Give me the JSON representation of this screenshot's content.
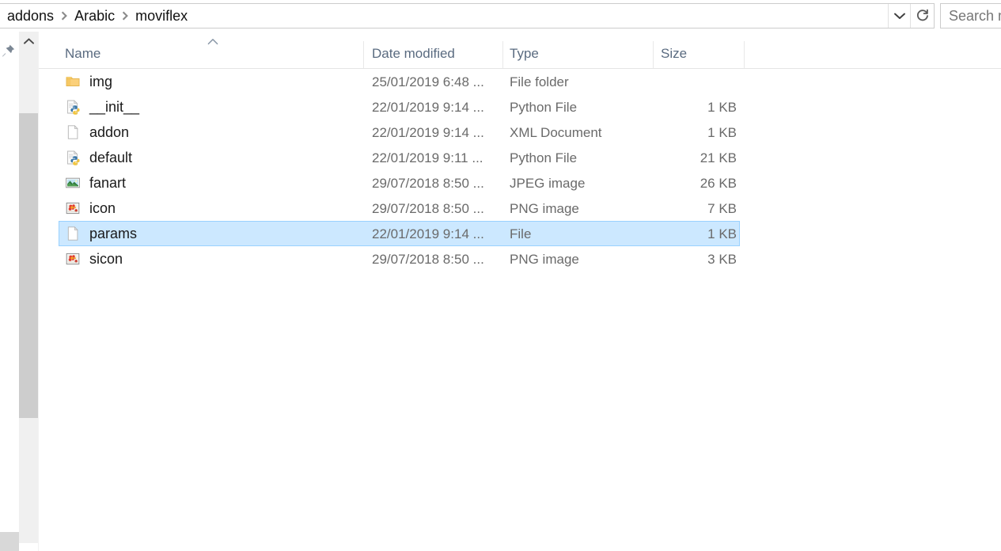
{
  "window": {
    "accent_selection_fill": "#cce8ff",
    "accent_selection_border": "#99d1ff",
    "header_text_color": "#5a6b80"
  },
  "address_bar": {
    "breadcrumb": [
      "addons",
      "Arabic",
      "moviflex"
    ],
    "separator_icon": "chevron-right-icon",
    "dropdown_icon": "chevron-down-icon",
    "refresh_icon": "refresh-icon"
  },
  "search": {
    "value": "",
    "visible_text": "Search m",
    "placeholder": "Search moviflex"
  },
  "nav_pane": {
    "pin_icon": "pin-icon",
    "scroll_up_icon": "chevron-up-icon"
  },
  "file_list": {
    "columns": [
      {
        "label": "Name",
        "key": "name"
      },
      {
        "label": "Date modified",
        "key": "date"
      },
      {
        "label": "Type",
        "key": "type"
      },
      {
        "label": "Size",
        "key": "size"
      }
    ],
    "sort": {
      "column": "Name",
      "direction": "ascending",
      "icon": "sort-ascending-icon"
    },
    "rows": [
      {
        "name": "img",
        "icon": "folder-icon",
        "date": "25/01/2019 6:48 ...",
        "type": "File folder",
        "size": "",
        "selected": false
      },
      {
        "name": "__init__",
        "icon": "python-file-icon",
        "date": "22/01/2019 9:14 ...",
        "type": "Python File",
        "size": "1 KB",
        "selected": false
      },
      {
        "name": "addon",
        "icon": "generic-file-icon",
        "date": "22/01/2019 9:14 ...",
        "type": "XML Document",
        "size": "1 KB",
        "selected": false
      },
      {
        "name": "default",
        "icon": "python-file-icon",
        "date": "22/01/2019 9:11 ...",
        "type": "Python File",
        "size": "21 KB",
        "selected": false
      },
      {
        "name": "fanart",
        "icon": "jpeg-image-icon",
        "date": "29/07/2018 8:50 ...",
        "type": "JPEG image",
        "size": "26 KB",
        "selected": false
      },
      {
        "name": "icon",
        "icon": "png-image-icon",
        "date": "29/07/2018 8:50 ...",
        "type": "PNG image",
        "size": "7 KB",
        "selected": false
      },
      {
        "name": "params",
        "icon": "generic-file-icon",
        "date": "22/01/2019 9:14 ...",
        "type": "File",
        "size": "1 KB",
        "selected": true
      },
      {
        "name": "sicon",
        "icon": "png-image-icon",
        "date": "29/07/2018 8:50 ...",
        "type": "PNG image",
        "size": "3 KB",
        "selected": false
      }
    ]
  }
}
